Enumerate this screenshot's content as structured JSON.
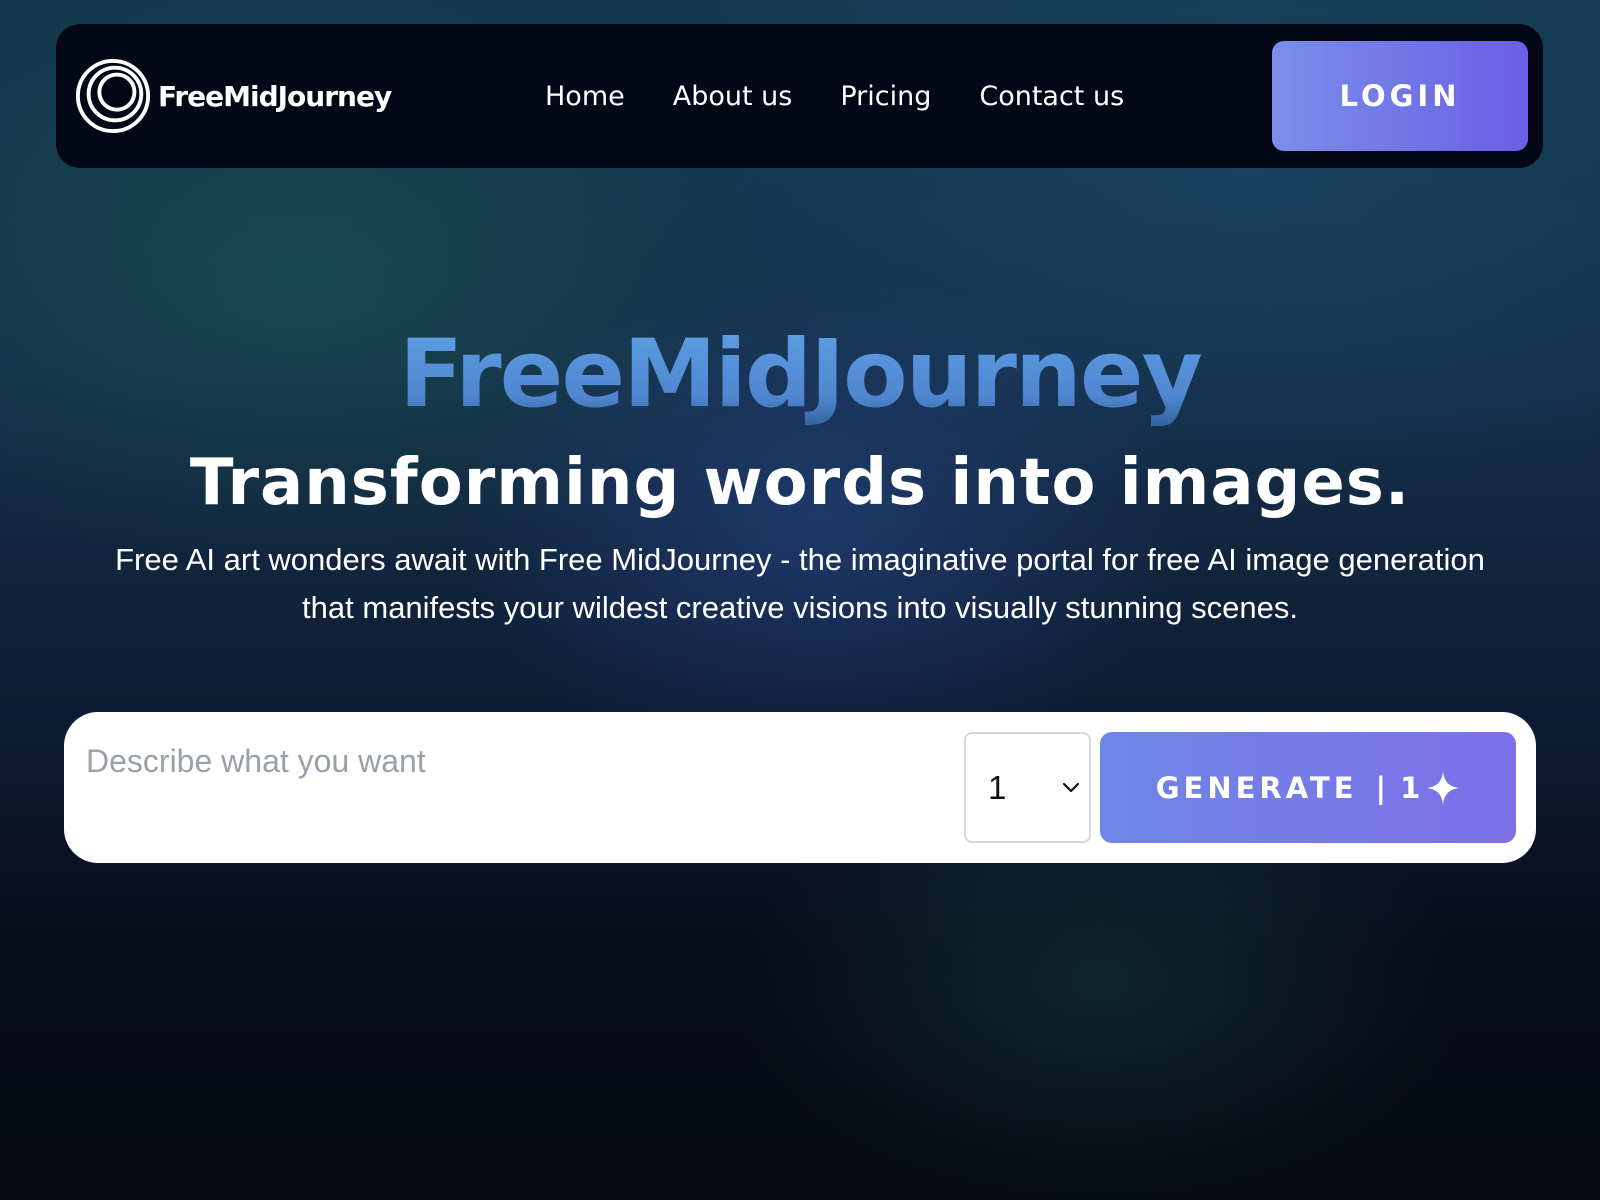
{
  "brand": {
    "logo_text": "FreeMidJourney",
    "logo_icon": "concentric-circles-logo-icon"
  },
  "nav": {
    "items": [
      {
        "label": "Home"
      },
      {
        "label": "About us"
      },
      {
        "label": "Pricing"
      },
      {
        "label": "Contact us"
      }
    ],
    "login_label": "LOGIN"
  },
  "hero": {
    "brand_title": "FreeMidJourney",
    "tagline": "Transforming words into images.",
    "description": "Free AI art wonders await with Free MidJourney - the imaginative portal for free AI image generation that manifests your wildest creative visions into visually stunning scenes."
  },
  "prompt": {
    "placeholder": "Describe what you want",
    "value": "",
    "count_selected": "1",
    "generate_label": "GENERATE",
    "generate_divider": "|",
    "generate_cost": "1",
    "generate_icon": "sparkle-icon"
  },
  "colors": {
    "accent_start": "#7a8fe8",
    "accent_end": "#6a5ee6",
    "brand_title": "#5b95db",
    "navbar_bg": "#030716"
  }
}
